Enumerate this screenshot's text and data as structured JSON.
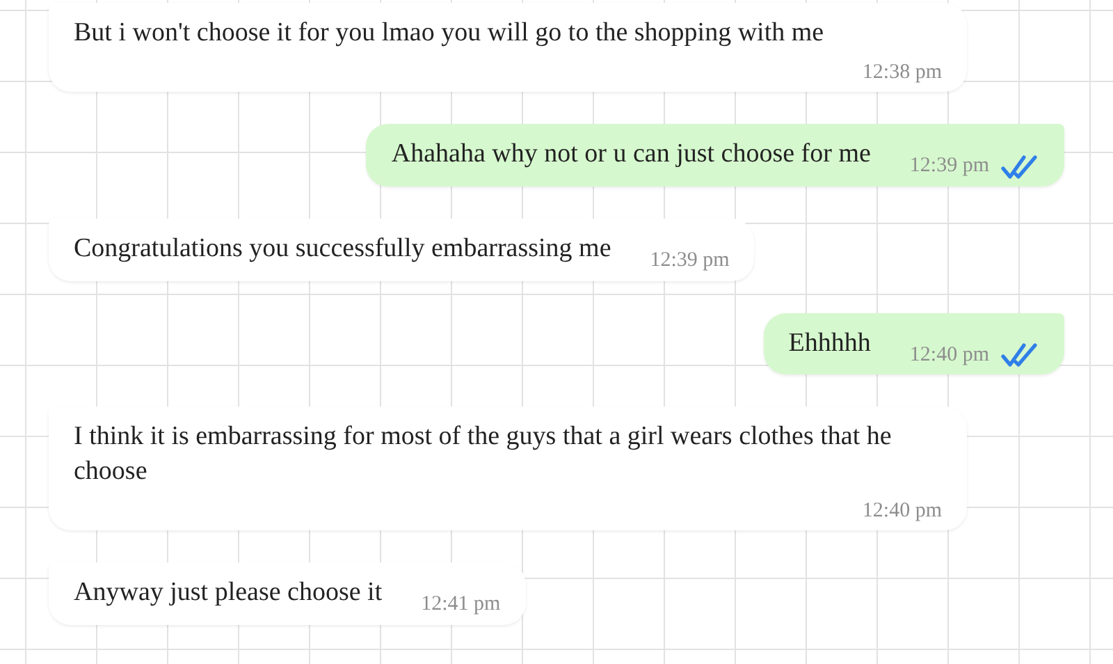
{
  "messages": [
    {
      "kind": "incoming",
      "text": "But i won't choose it for you lmao you will go to the shopping with me",
      "time": "12:38 pm"
    },
    {
      "kind": "outgoing",
      "text": "Ahahaha why not or u can just choose for me",
      "time": "12:39 pm",
      "read": true
    },
    {
      "kind": "incoming",
      "text": "Congratulations you successfully embarrassing me",
      "time": "12:39 pm"
    },
    {
      "kind": "outgoing",
      "text": "Ehhhhh",
      "time": "12:40 pm",
      "read": true
    },
    {
      "kind": "incoming",
      "text": "I think it is embarrassing for most of the guys that a girl wears clothes that he choose",
      "time": "12:40 pm"
    },
    {
      "kind": "incoming",
      "text": "Anyway just please choose it",
      "time": "12:41 pm"
    }
  ]
}
